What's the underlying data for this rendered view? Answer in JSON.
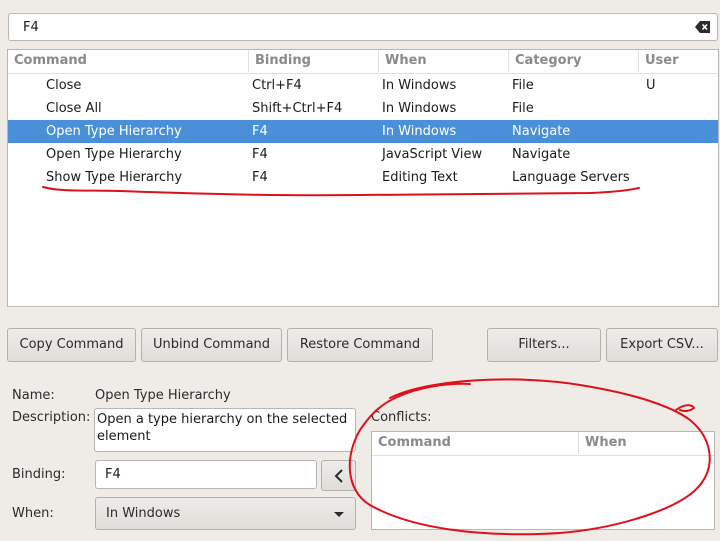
{
  "search": {
    "value": "F4"
  },
  "table": {
    "columns": [
      "Command",
      "Binding",
      "When",
      "Category",
      "User"
    ],
    "rows": [
      {
        "command": "Close",
        "binding": "Ctrl+F4",
        "when": "In Windows",
        "category": "File",
        "user": "U"
      },
      {
        "command": "Close All",
        "binding": "Shift+Ctrl+F4",
        "when": "In Windows",
        "category": "File",
        "user": ""
      },
      {
        "command": "Open Type Hierarchy",
        "binding": "F4",
        "when": "In Windows",
        "category": "Navigate",
        "user": "",
        "selected": true
      },
      {
        "command": "Open Type Hierarchy",
        "binding": "F4",
        "when": "JavaScript View",
        "category": "Navigate",
        "user": ""
      },
      {
        "command": "Show Type Hierarchy",
        "binding": "F4",
        "when": "Editing Text",
        "category": "Language Servers",
        "user": ""
      }
    ]
  },
  "buttons": {
    "copy": "Copy Command",
    "unbind": "Unbind Command",
    "restore": "Restore Command",
    "filters": "Filters...",
    "export": "Export CSV..."
  },
  "details": {
    "name_label": "Name:",
    "name_value": "Open Type Hierarchy",
    "description_label": "Description:",
    "description_value": "Open a type hierarchy on the selected element",
    "binding_label": "Binding:",
    "binding_value": "F4",
    "when_label": "When:",
    "when_value": "In Windows"
  },
  "conflicts": {
    "label": "Conflicts:",
    "columns": [
      "Command",
      "When"
    ]
  },
  "colors": {
    "selection": "#4a90d9",
    "annotation": "#e0101a"
  }
}
